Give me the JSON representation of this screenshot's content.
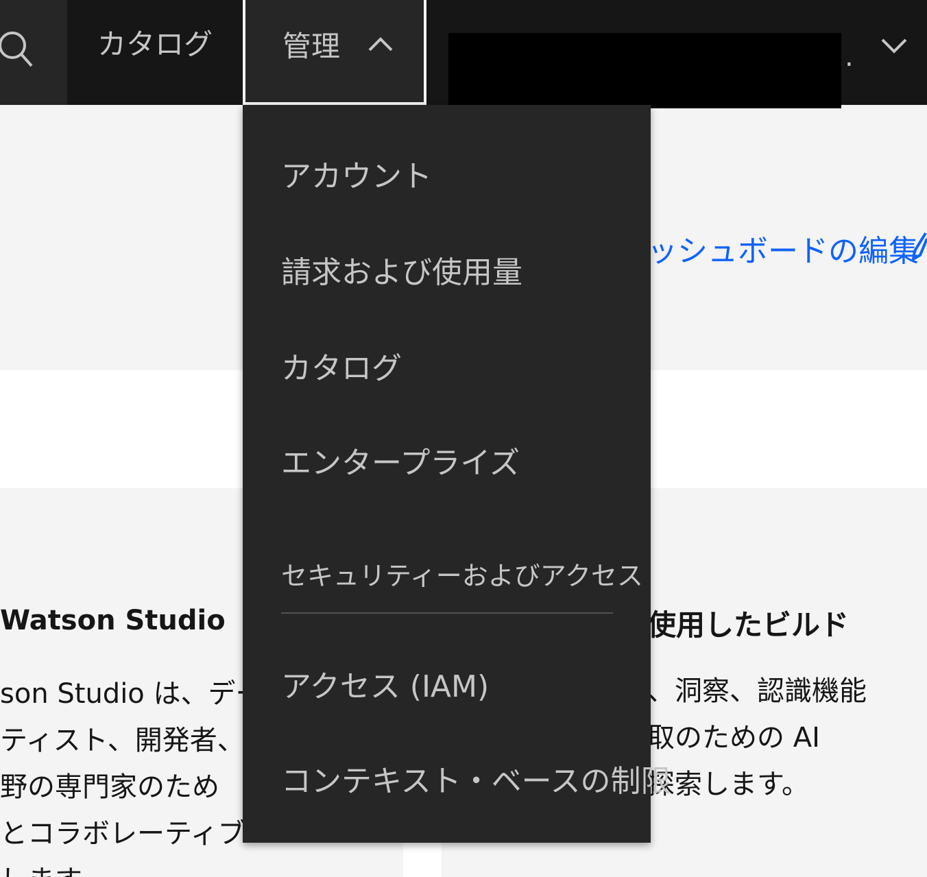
{
  "header": {
    "nav_catalog": "カタログ",
    "nav_manage": "管理",
    "account_suffix": "."
  },
  "dashboard": {
    "edit_link": "ッシュボードの編集"
  },
  "cards": {
    "left": {
      "title": "Watson Studio",
      "desc_lines": [
        "son Studio は、デー",
        "ティスト、開発者、お",
        "野の専門家のため",
        "とコラボレーティブな",
        "します"
      ]
    },
    "right": {
      "title": "使用したビルド",
      "desc_lines": [
        "、洞察、認識機能",
        "取のための AI",
        "探索します。"
      ]
    }
  },
  "manage_menu": {
    "items": [
      "アカウント",
      "請求および使用量",
      "カタログ",
      "エンタープライズ"
    ],
    "section_header": "セキュリティーおよびアクセス",
    "section_items": [
      "アクセス (IAM)",
      "コンテキスト・ベースの制限"
    ]
  }
}
